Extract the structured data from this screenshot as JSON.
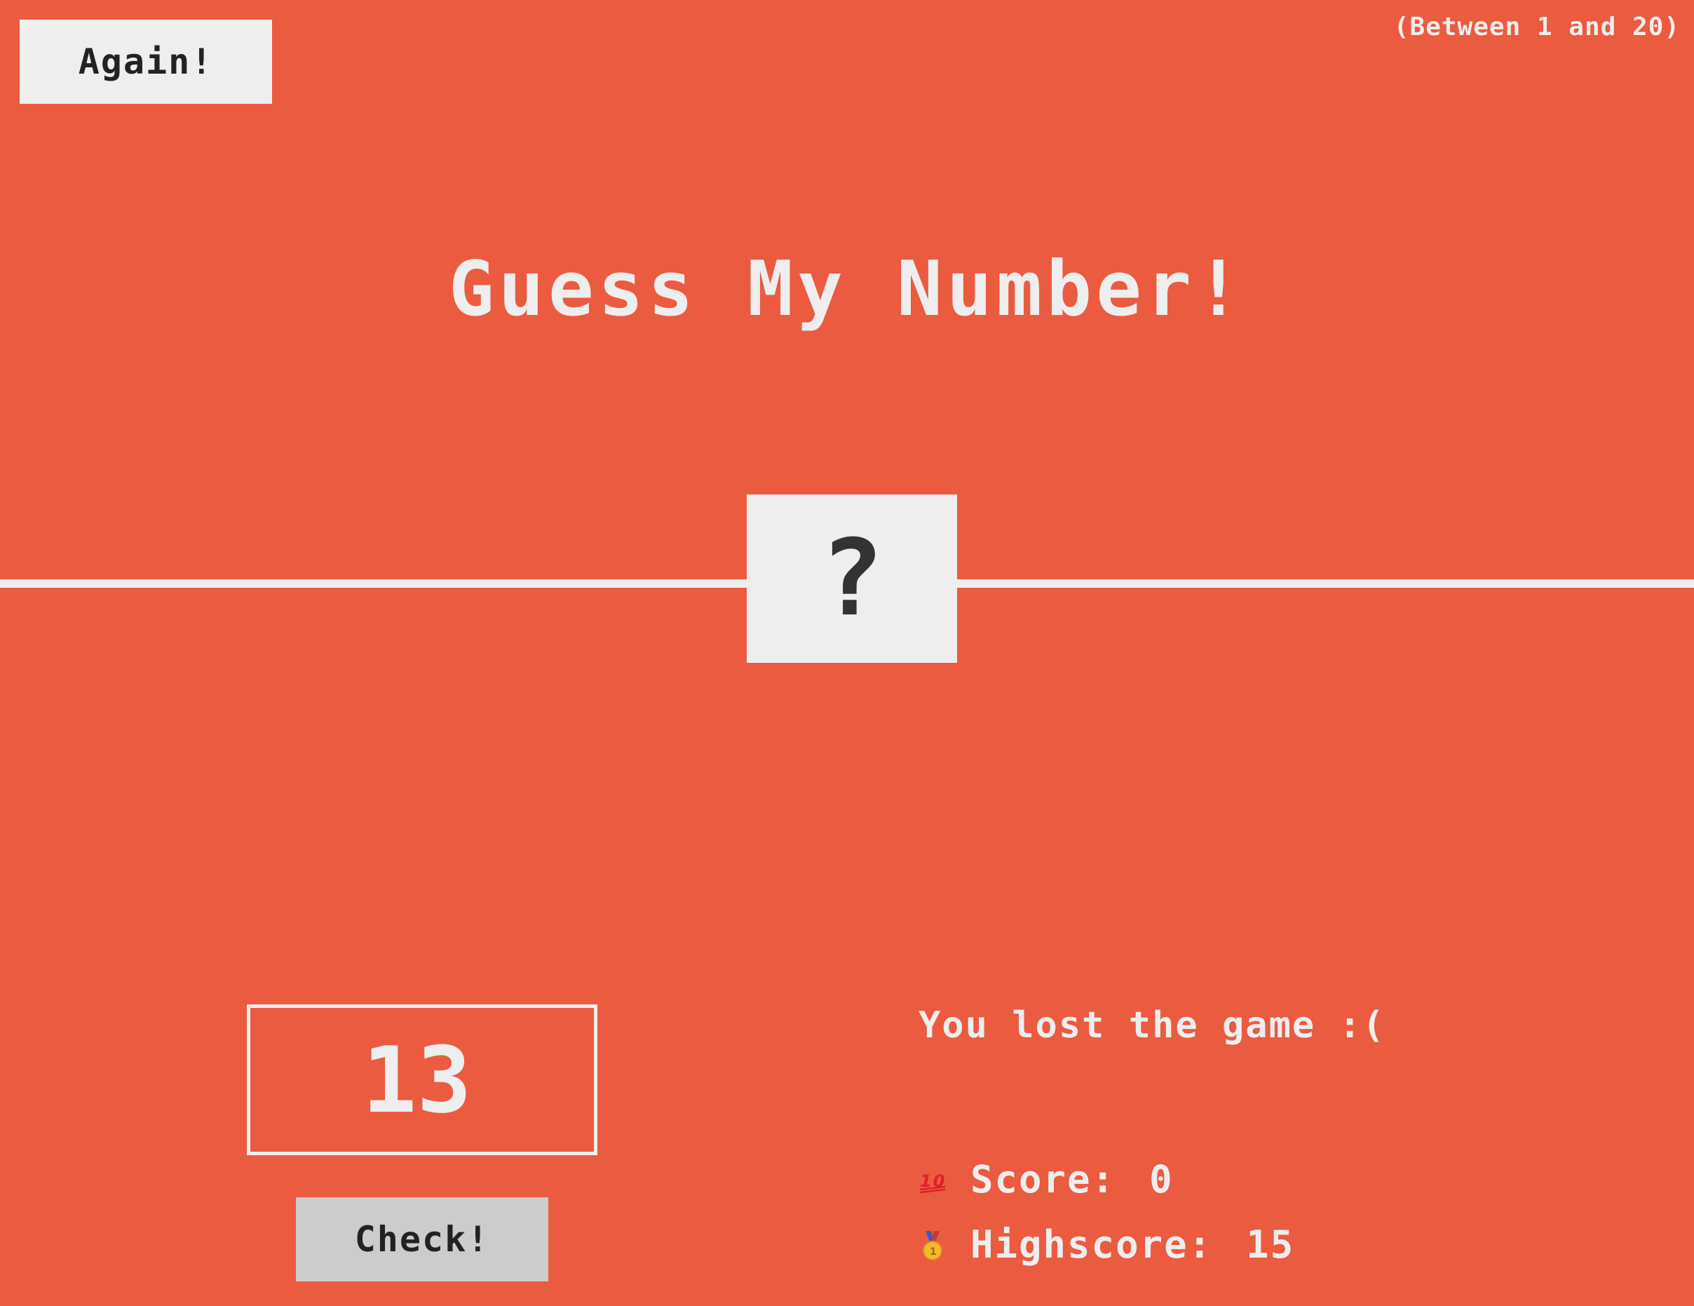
{
  "header": {
    "again_label": "Again!",
    "range_hint": "(Between 1 and 20)"
  },
  "title": "Guess My Number!",
  "secret": {
    "display": "?"
  },
  "left_panel": {
    "guess_value": "13",
    "check_label": "Check!"
  },
  "right_panel": {
    "message": "You lost the game :(",
    "score_label": "Score:",
    "score_value": "0",
    "highscore_label": "Highscore:",
    "highscore_value": "15",
    "score_icon": "hundred-points-icon",
    "highscore_icon": "medal-icon"
  },
  "colors": {
    "background": "#eb5b40",
    "foreground": "#eeeeee",
    "dark_text": "#333333",
    "check_button": "#cccccc"
  }
}
